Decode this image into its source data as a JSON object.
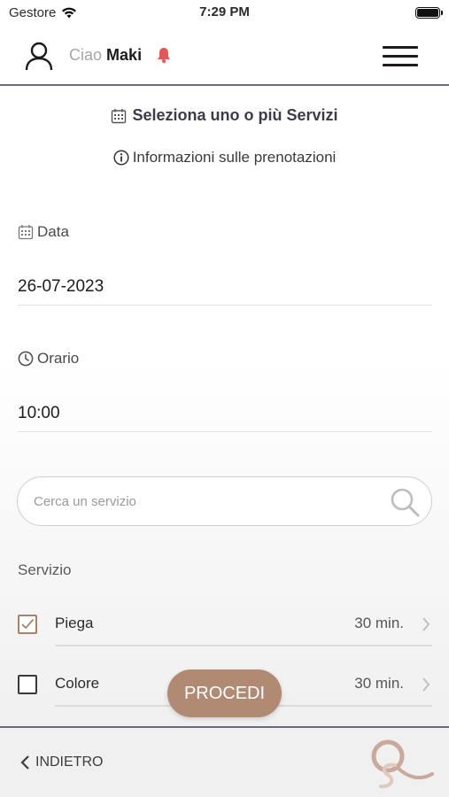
{
  "status_bar": {
    "carrier": "Gestore",
    "time": "7:29 PM"
  },
  "header": {
    "greeting": "Ciao",
    "user_name": "Maki"
  },
  "title": "Seleziona uno o più Servizi",
  "info_link": "Informazioni sulle prenotazioni",
  "date_field": {
    "label": "Data",
    "value": "26-07-2023"
  },
  "time_field": {
    "label": "Orario",
    "value": "10:00"
  },
  "search": {
    "placeholder": "Cerca un servizio"
  },
  "services_label": "Servizio",
  "services": [
    {
      "name": "Piega",
      "duration": "30 min.",
      "checked": true
    },
    {
      "name": "Colore",
      "duration": "30 min.",
      "checked": false
    }
  ],
  "proceed_label": "PROCEDI",
  "back_label": "INDIETRO",
  "colors": {
    "accent": "#b18a74",
    "divider": "#6c6a7a",
    "bell": "#e05a5a"
  }
}
